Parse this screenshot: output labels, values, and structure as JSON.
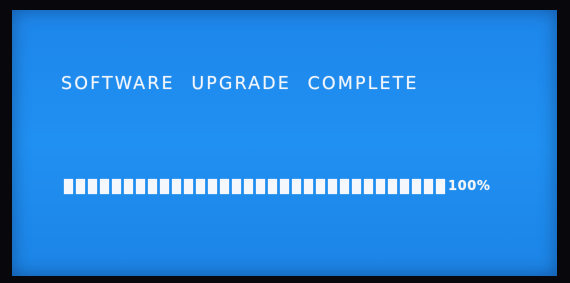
{
  "screen": {
    "title": "SOFTWARE UPGRADE COMPLETE",
    "background_color": "#1f8df0",
    "text_color": "#f2f6fb"
  },
  "progress": {
    "segments_total": 32,
    "segments_filled": 32,
    "fraction": 1.0,
    "label": "100%"
  }
}
